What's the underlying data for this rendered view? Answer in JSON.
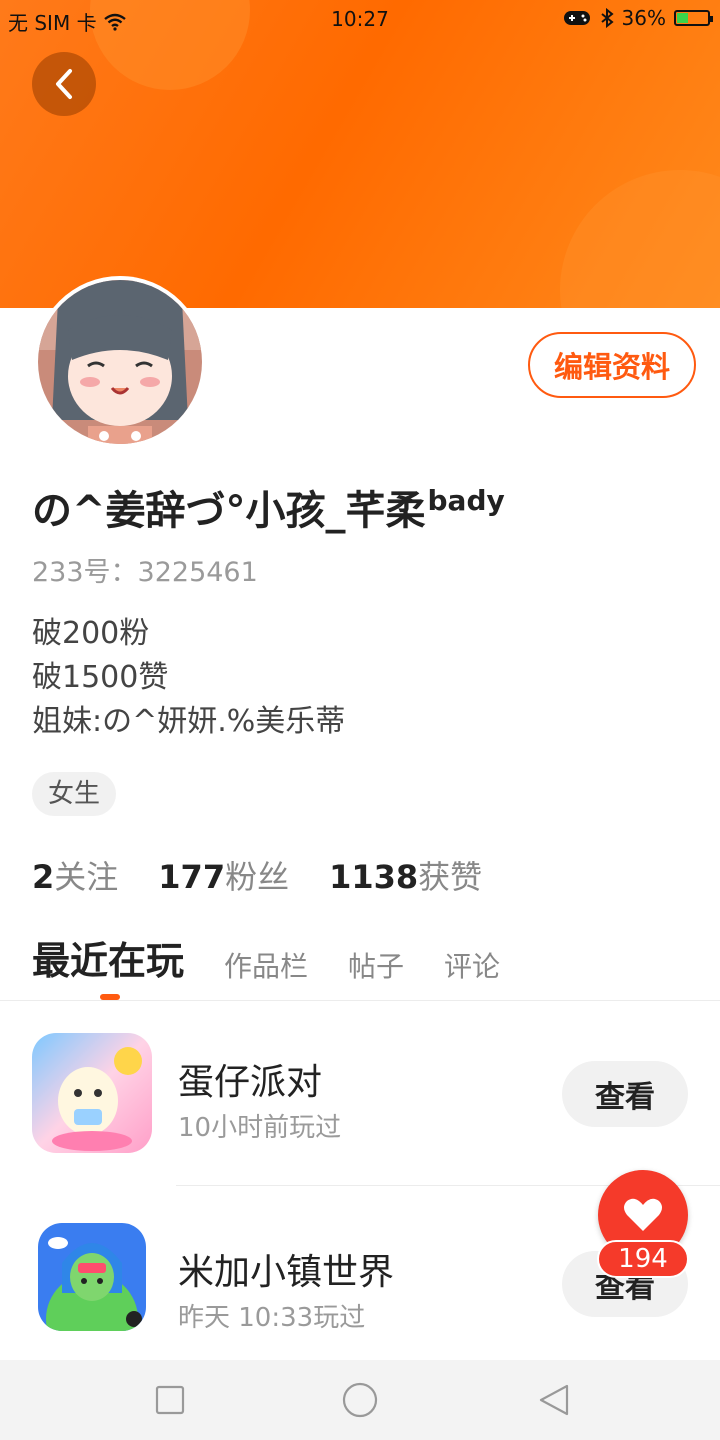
{
  "status_bar": {
    "carrier": "无 SIM 卡",
    "time": "10:27",
    "battery": "36%",
    "battery_level": 0.36
  },
  "header": {
    "back_icon": "chevron-left-icon",
    "colors": {
      "accent": "#ff6a00",
      "brand": "#ff5a10"
    }
  },
  "profile": {
    "edit_label": "编辑资料",
    "username": "の^姜辞づ°小孩_芊柔",
    "username_sup": "bady",
    "uid": "233号：3225461",
    "bio": [
      "破200粉",
      "破1500赞",
      "姐妹:の^妍妍.%美乐蒂"
    ],
    "tag": "女生",
    "stats": [
      {
        "count": "2",
        "label": "关注"
      },
      {
        "count": "177",
        "label": "粉丝"
      },
      {
        "count": "1138",
        "label": "获赞"
      }
    ]
  },
  "tabs": [
    {
      "label": "最近在玩",
      "active": true
    },
    {
      "label": "作品栏",
      "active": false
    },
    {
      "label": "帖子",
      "active": false
    },
    {
      "label": "评论",
      "active": false
    }
  ],
  "games": [
    {
      "name": "蛋仔派对",
      "time": "10小时前玩过",
      "button": "查看"
    },
    {
      "name": "米加小镇世界",
      "time": "昨天 10:33玩过",
      "button": "查看"
    }
  ],
  "like": {
    "count": "194",
    "icon": "heart-icon"
  },
  "nav": {
    "square_icon": "recent-apps-icon",
    "circle_icon": "home-icon",
    "triangle_icon": "back-icon"
  }
}
